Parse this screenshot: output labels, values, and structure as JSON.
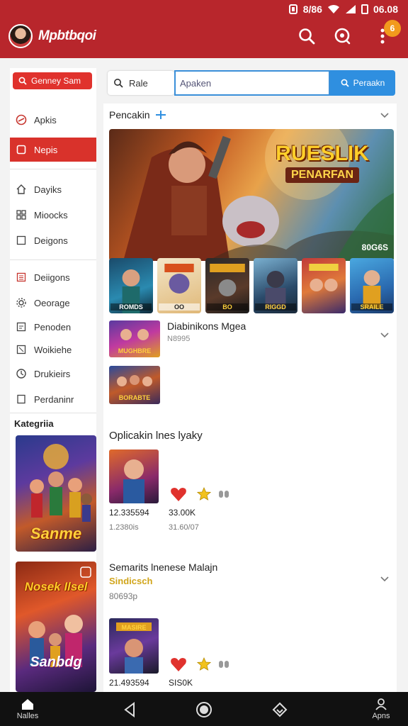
{
  "status_bar": {
    "carrier": "8/86",
    "time": "06.08"
  },
  "app": {
    "title": "Mpbtbqoi",
    "notification_count": "6"
  },
  "sidebar": {
    "primary_button": "Genney Sam",
    "items": [
      {
        "label": "Apkis",
        "icon": "target-icon",
        "active": false
      },
      {
        "label": "Nepis",
        "icon": "square-icon",
        "active": true
      },
      {
        "label": "Dayiks",
        "icon": "home-icon",
        "active": false
      },
      {
        "label": "Mioocks",
        "icon": "grid-icon",
        "active": false
      },
      {
        "label": "Deigons",
        "icon": "square-outline-icon",
        "active": false
      },
      {
        "label": "Deiigons",
        "icon": "list-icon",
        "active": false
      },
      {
        "label": "Oeorage",
        "icon": "gear-icon",
        "active": false
      },
      {
        "label": "Penoden",
        "icon": "doc-icon",
        "active": false
      },
      {
        "label": "Woikiehe",
        "icon": "note-icon",
        "active": false
      },
      {
        "label": "Drukieirs",
        "icon": "clock-icon",
        "active": false
      },
      {
        "label": "Perdaninr",
        "icon": "page-icon",
        "active": false
      }
    ],
    "category_label": "Kategriia",
    "posters": [
      {
        "title": "Sanme"
      },
      {
        "title": "Sanbdg"
      }
    ],
    "poster2_top_text": "Nosek Ilsel"
  },
  "search": {
    "left_label": "Rale",
    "input_value": "Apaken",
    "button_label": "Peraakn"
  },
  "main": {
    "featured": {
      "heading": "Pencakin",
      "title_line1": "RUESLIK",
      "title_line2": "PENARFAN",
      "badge": "80G6S",
      "thumb_caps": [
        "ROMDS",
        "OO",
        "BO",
        "RIGGD",
        "",
        "SRAILE"
      ]
    },
    "row1": {
      "title": "Diabinikons Mgea",
      "subtitle": "N8995",
      "image_cap": "MUGHBRE"
    },
    "row1b": {
      "image_cap": "BORABTE"
    },
    "section2": {
      "heading": "Oplicakin lnes lyaky",
      "stat1": "12.335594",
      "stat1_sub": "1.2380is",
      "stat2": "33.00K",
      "stat2_sub": "31.60/07"
    },
    "section3": {
      "heading": "Semarits lnenese Malajn",
      "subheading": "Sindicsch",
      "meta": "80693p",
      "stat1": "21.493594",
      "stat2": "SIS0K",
      "image_cap": "MASIRE"
    },
    "colors": {
      "accent": "#b8262c",
      "active": "#d9322b",
      "link_blue": "#2f8fe0"
    }
  },
  "navbar": {
    "home_label": "Nalles",
    "profile_label": "Apns"
  }
}
